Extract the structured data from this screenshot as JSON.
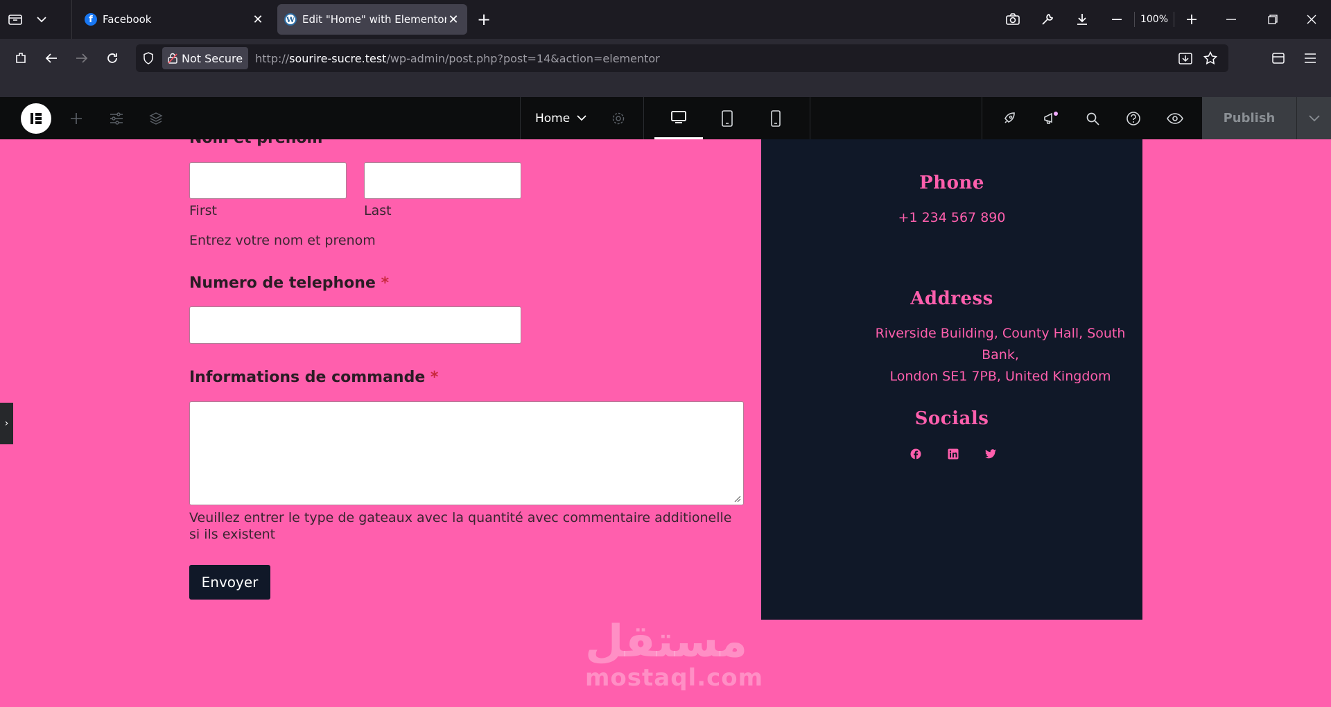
{
  "browser": {
    "tabs": [
      {
        "title": "Facebook"
      },
      {
        "title": "Edit \"Home\" with Elementor"
      }
    ],
    "zoom": "100%",
    "security_label": "Not Secure",
    "url_prefix": "http://",
    "url_host": "sourire-sucre.test",
    "url_path": "/wp-admin/post.php?post=14&action=elementor"
  },
  "elementor": {
    "page_name": "Home",
    "publish_label": "Publish"
  },
  "form": {
    "name_label": "Nom et prenom",
    "first_label": "First",
    "last_label": "Last",
    "name_description": "Entrez votre nom et prenom",
    "phone_label": "Numero de telephone",
    "order_label": "Informations de commande",
    "order_description": "Veuillez entrer le type de gateaux avec la quantité avec commentaire additionelle si ils existent",
    "required_mark": "*",
    "submit_label": "Envoyer"
  },
  "contact": {
    "phone_title": "Phone",
    "phone_value": "+1 234 567 890",
    "address_title": "Address",
    "address_line1": "Riverside Building, County Hall, South Bank,",
    "address_line2": "London SE1 7PB, United Kingdom",
    "socials_title": "Socials",
    "socials": [
      "facebook-icon",
      "linkedin-icon",
      "twitter-icon"
    ]
  },
  "watermark": {
    "arabic": "مستقل",
    "latin": "mostaql.com"
  },
  "colors": {
    "page_bg": "#ff5fad",
    "panel_bg": "#101828",
    "accent": "#ff5fad"
  }
}
